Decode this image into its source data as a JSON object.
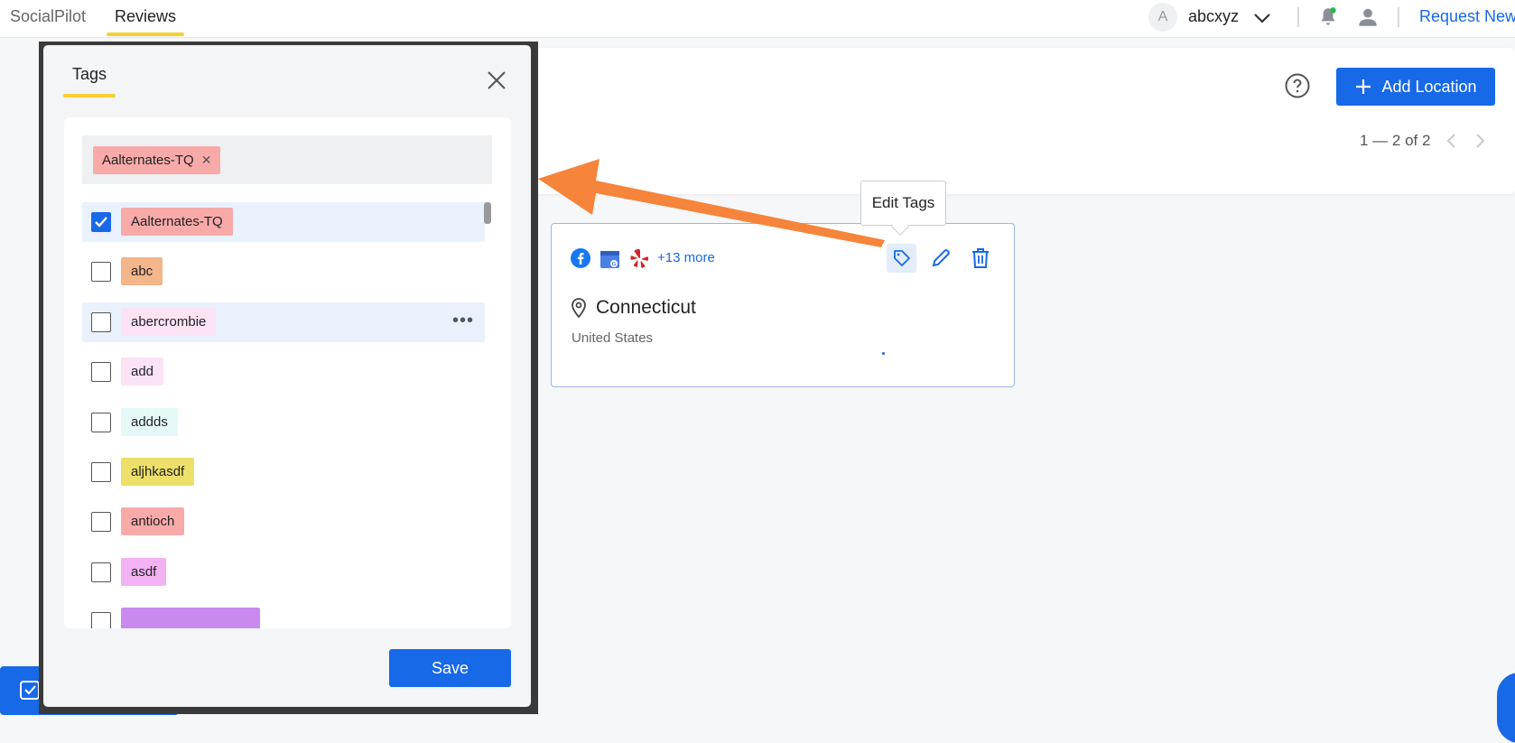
{
  "nav": {
    "brand": "SocialPilot",
    "tab_reviews": "Reviews",
    "avatar_letter": "A",
    "user_name": "abcxyz",
    "request_new": "Request New"
  },
  "header": {
    "add_location": "Add Location",
    "pager": "1 — 2 of 2"
  },
  "location_card": {
    "more": "+13 more",
    "name": "Connecticut",
    "country": "United States",
    "tooltip": "Edit Tags"
  },
  "modal": {
    "tab": "Tags",
    "selected_chip": "Aalternates-TQ",
    "save": "Save",
    "tags": [
      {
        "label": "Aalternates-TQ",
        "checked": true,
        "color": "#f8aaa9"
      },
      {
        "label": "abc",
        "checked": false,
        "color": "#f3b58a"
      },
      {
        "label": "abercrombie",
        "checked": false,
        "color": "#fbe3f4"
      },
      {
        "label": "add",
        "checked": false,
        "color": "#fbe3f4"
      },
      {
        "label": "addds",
        "checked": false,
        "color": "#e5f9f9"
      },
      {
        "label": "aljhkasdf",
        "checked": false,
        "color": "#ece06a"
      },
      {
        "label": "antioch",
        "checked": false,
        "color": "#f8aaa9"
      },
      {
        "label": "asdf",
        "checked": false,
        "color": "#f2b2f3"
      },
      {
        "label": "",
        "checked": false,
        "color": "#c98af0"
      }
    ]
  },
  "colors": {
    "primary": "#1769e8",
    "accent_underline": "#f7cf32",
    "annotation_arrow": "#f6843a"
  }
}
